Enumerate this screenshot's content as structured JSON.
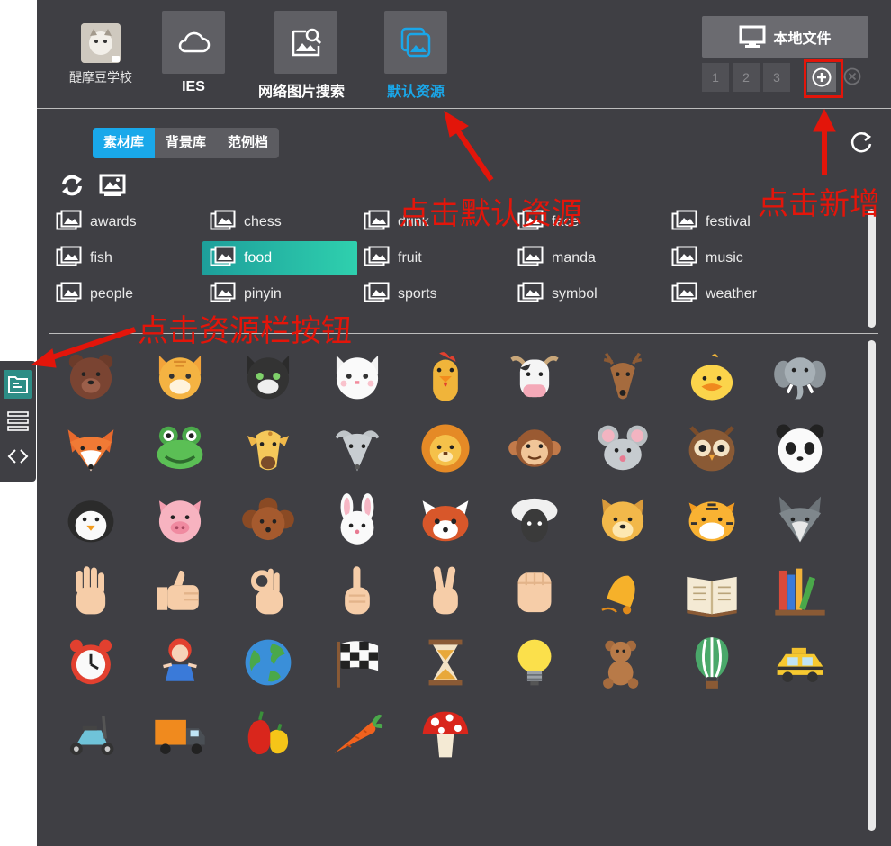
{
  "header": {
    "school_name": "醍摩豆学校",
    "tabs": [
      {
        "label": "IES",
        "icon": "cloud-icon",
        "active": false
      },
      {
        "label": "网络图片搜索",
        "icon": "image-search-icon",
        "active": false
      },
      {
        "label": "默认资源",
        "icon": "default-resource-icon",
        "active": true
      }
    ],
    "local_file_label": "本地文件",
    "pages": [
      "1",
      "2",
      "3"
    ]
  },
  "library_tabs": [
    {
      "label": "素材库",
      "active": true
    },
    {
      "label": "背景库",
      "active": false
    },
    {
      "label": "范例档",
      "active": false
    }
  ],
  "categories": [
    "awards",
    "chess",
    "drink",
    "face",
    "festival",
    "fish",
    "food",
    "fruit",
    "manda",
    "music",
    "people",
    "pinyin",
    "sports",
    "symbol",
    "weather"
  ],
  "selected_category": "food",
  "stickers": [
    "bear",
    "cat-orange",
    "cat-black",
    "cat-white",
    "rooster",
    "cow",
    "deer",
    "chick",
    "elephant",
    "fox",
    "frog",
    "giraffe",
    "mouse-gray",
    "lion",
    "monkey",
    "mouse",
    "owl",
    "panda",
    "penguin",
    "pig",
    "poodle",
    "rabbit",
    "red-panda",
    "sheep",
    "dog",
    "tiger",
    "wolf",
    "palm",
    "thumbs-up",
    "ok-hand",
    "pointing-finger",
    "victory-hand",
    "fist",
    "bell",
    "open-book",
    "books",
    "alarm-clock",
    "girl-doll",
    "globe",
    "checkered-flag",
    "hourglass",
    "light-bulb",
    "teddy-bear",
    "hot-air-balloon",
    "taxi",
    "scooter",
    "truck",
    "peppers",
    "carrot",
    "mushroom"
  ],
  "sidebar": [
    {
      "name": "resource-panel-icon",
      "active": true
    },
    {
      "name": "list-icon",
      "active": false
    },
    {
      "name": "code-icon",
      "active": false
    }
  ],
  "annotations": {
    "default_resource": "点击默认资源",
    "add_new": "点击新增",
    "resource_button": "点击资源栏按钮"
  },
  "colors": {
    "accent": "#19a8ea",
    "annotation": "#e3150a",
    "panel": "#3f3f44",
    "selected_category": "#2fd0ae"
  }
}
